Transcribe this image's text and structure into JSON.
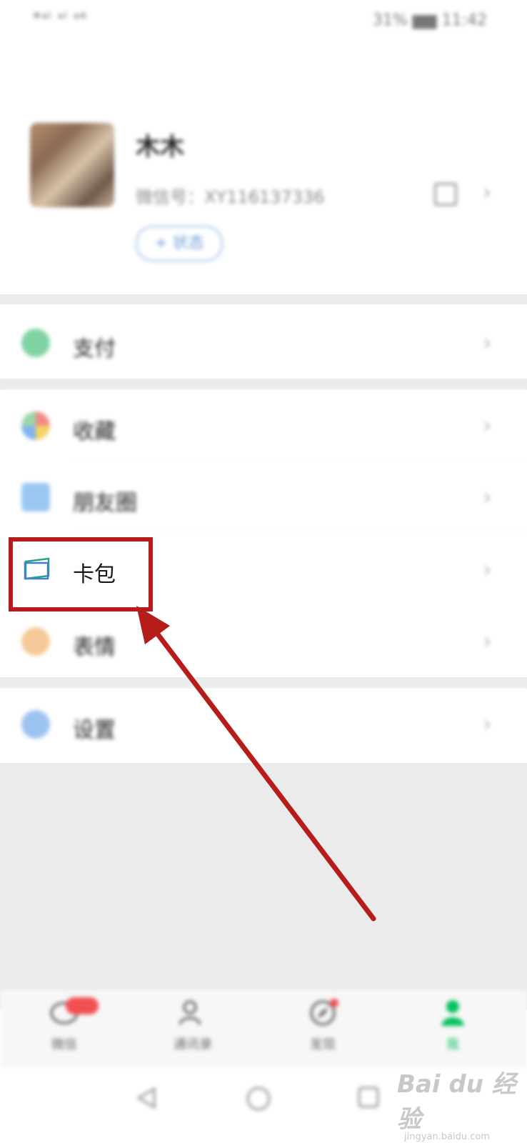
{
  "status_bar": {
    "left": "*ᵃˡ ᵃˡ ᵃ⁶",
    "right": "31% ▆▆ 11:42"
  },
  "profile": {
    "nickname": "木木",
    "wechat_id": "微信号：XY116137336",
    "status_button": "+ 状态"
  },
  "menu": [
    {
      "label": "支付",
      "icon": "wallet-icon"
    },
    {
      "label": "收藏",
      "icon": "favorites-icon"
    },
    {
      "label": "朋友圈",
      "icon": "moments-icon"
    },
    {
      "label": "卡包",
      "icon": "card-wallet-icon",
      "highlighted": true
    },
    {
      "label": "表情",
      "icon": "sticker-icon"
    },
    {
      "label": "设置",
      "icon": "settings-icon"
    }
  ],
  "tabbar": [
    {
      "label": "微信",
      "icon": "chat-icon"
    },
    {
      "label": "通讯录",
      "icon": "contacts-icon"
    },
    {
      "label": "发现",
      "icon": "discover-icon"
    },
    {
      "label": "我",
      "icon": "me-icon",
      "active": true
    }
  ],
  "annotation": {
    "color": "#b51c1a"
  },
  "watermark": {
    "main": "Bai du 经验",
    "sub": "jingyan.baidu.com"
  },
  "colors": {
    "wechat_green": "#07c160",
    "highlight_red": "#b51c1a"
  }
}
